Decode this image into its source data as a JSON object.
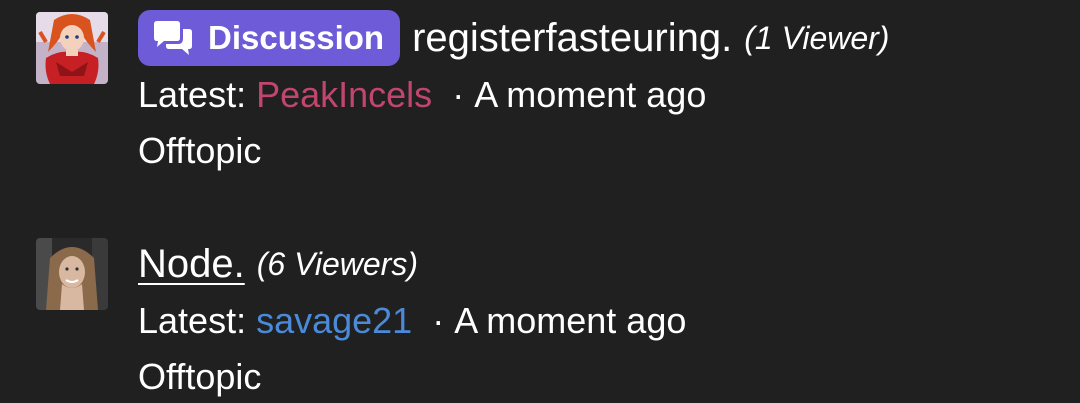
{
  "threads": [
    {
      "prefix": "Discussion",
      "prefix_icon": "chat-bubbles-icon",
      "prefix_color": "#6e5bd8",
      "title": "registerfasteuring.",
      "viewers": "(1 Viewer)",
      "latest_label": "Latest:",
      "latest_user": "PeakIncels",
      "latest_user_color": "#c0466e",
      "separator": "·",
      "time": "A moment ago",
      "forum": "Offtopic"
    },
    {
      "title": "Node.",
      "viewers": "(6 Viewers)",
      "latest_label": "Latest:",
      "latest_user": "savage21",
      "latest_user_color": "#4a8ad8",
      "separator": "·",
      "time": "A moment ago",
      "forum": "Offtopic"
    }
  ]
}
